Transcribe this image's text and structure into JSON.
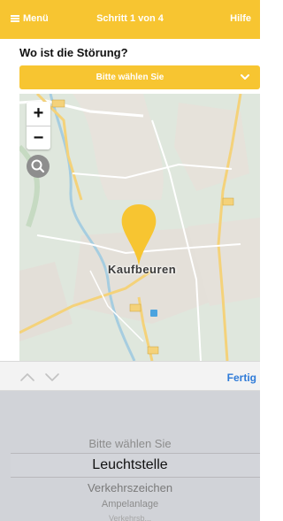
{
  "header": {
    "menu_label": "Menü",
    "title": "Schritt 1 von 4",
    "help_label": "Hilfe"
  },
  "question": "Wo ist die Störung?",
  "category_select": {
    "label": "Bitte wählen Sie"
  },
  "map": {
    "zoom_in": "+",
    "zoom_out": "−",
    "city_label": "Kaufbeuren",
    "pin_color": "#f7c531"
  },
  "picker": {
    "done_label": "Fertig",
    "options": [
      "Bitte wählen Sie",
      "Leuchtstelle",
      "Verkehrszeichen",
      "Ampelanlage",
      "Verkehrsb..."
    ],
    "selected": "Leuchtstelle"
  },
  "colors": {
    "accent": "#f7c531",
    "link": "#2f7bd8"
  }
}
